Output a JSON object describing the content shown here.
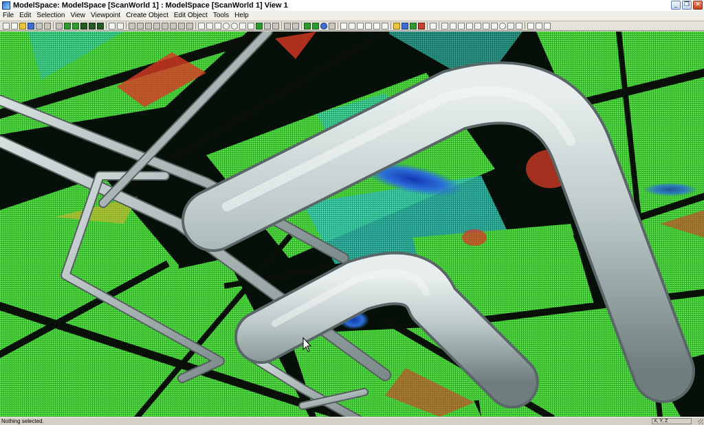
{
  "window": {
    "title": "ModelSpace: ModelSpace [ScanWorld 1] : ModelSpace [ScanWorld 1] View 1",
    "controls": {
      "minimize": "_",
      "restore": "❐",
      "close": "✕"
    }
  },
  "menu": {
    "items": [
      "File",
      "Edit",
      "Selection",
      "View",
      "Viewpoint",
      "Create Object",
      "Edit Object",
      "Tools",
      "Help"
    ]
  },
  "toolbar": {
    "buttons": [
      "picking-tool-icon",
      "new-icon",
      "open-icon",
      "save-icon",
      "print-icon",
      "properties-icon",
      "cut-icon",
      "copy-icon",
      "paste-icon",
      "point-size-icon",
      "color-map-icon",
      "pan-icon",
      "zoom-in-icon",
      "zoom-out-icon",
      "zoom-extents-icon",
      "seek-icon",
      "rotate-icon",
      "fence-icon",
      "clip-icon",
      "measure-icon",
      "fit-cylinder-icon",
      "fit-elbow-icon",
      "fit-plane-icon",
      "region-grow-icon",
      "select-arrow-icon",
      "rectangle-select-icon",
      "polygon-select-icon",
      "cross-select-icon",
      "circle-select-icon",
      "lasso-select-icon"
    ]
  },
  "colors": {
    "scan_green": "#3bd13a",
    "scan_cyan": "#30c7b4",
    "scan_blue": "#1f4fc0",
    "scan_red": "#d83a26",
    "pipe_gray": "#b9c4c4",
    "background": "#061008"
  },
  "status": {
    "message": "Nothing selected.",
    "coordinates": "X, Y, Z"
  }
}
